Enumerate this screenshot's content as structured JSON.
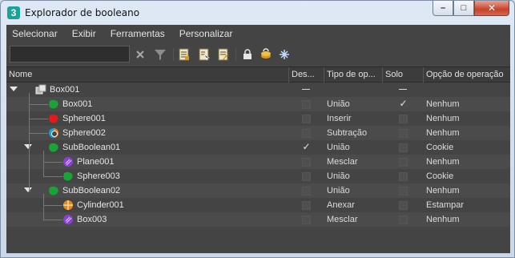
{
  "window": {
    "title": "Explorador de booleano",
    "app_icon_glyph": "3",
    "buttons": {
      "minimize": "–",
      "maximize": "□",
      "close": "✕"
    }
  },
  "menu": [
    "Selecionar",
    "Exibir",
    "Ferramentas",
    "Personalizar"
  ],
  "toolbar": {
    "search_value": "",
    "icons": [
      "clear-search-icon",
      "filter-icon",
      "document-list-icon",
      "document-select-icon",
      "document-edit-icon",
      "lock-icon",
      "layers-icon",
      "freeze-icon"
    ]
  },
  "columns": [
    "Nome",
    "Des...",
    "Tipo de op...",
    "Solo",
    "Opção de operação"
  ],
  "rows": [
    {
      "name": "Box001",
      "level": 0,
      "expandable": true,
      "icon": "boolean-object-icon",
      "icon_color": "#d8d8d8",
      "disable": "dash",
      "type": "",
      "solo": "dash",
      "op": ""
    },
    {
      "name": "Box001",
      "level": 1,
      "expandable": false,
      "icon": "green-operand-icon",
      "icon_color": "#19a535",
      "disable": "off",
      "type": "União",
      "solo": "on",
      "op": "Nenhum"
    },
    {
      "name": "Sphere001",
      "level": 1,
      "expandable": false,
      "icon": "red-operand-icon",
      "icon_color": "#e01b1b",
      "disable": "off",
      "type": "Inserir",
      "solo": "off",
      "op": "Nenhum"
    },
    {
      "name": "Sphere002",
      "level": 1,
      "expandable": false,
      "icon": "subtract-operand-icon",
      "icon_color": "#1ea0e0",
      "disable": "off",
      "type": "Subtração",
      "solo": "off",
      "op": "Nenhum"
    },
    {
      "name": "SubBoolean01",
      "level": 1,
      "expandable": true,
      "icon": "green-operand-icon",
      "icon_color": "#19a535",
      "disable": "on",
      "type": "União",
      "solo": "off",
      "op": "Cookie"
    },
    {
      "name": "Plane001",
      "level": 2,
      "expandable": false,
      "icon": "purple-operand-icon",
      "icon_color": "#8a3fd6",
      "disable": "off",
      "type": "Mesclar",
      "solo": "off",
      "op": "Nenhum"
    },
    {
      "name": "Sphere003",
      "level": 2,
      "expandable": false,
      "icon": "green-operand-icon",
      "icon_color": "#19a535",
      "disable": "off",
      "type": "União",
      "solo": "off",
      "op": "Cookie"
    },
    {
      "name": "SubBoolean02",
      "level": 1,
      "expandable": true,
      "icon": "green-operand-icon",
      "icon_color": "#19a535",
      "disable": "off",
      "type": "União",
      "solo": "off",
      "op": "Nenhum"
    },
    {
      "name": "Cylinder001",
      "level": 2,
      "expandable": false,
      "icon": "orange-attach-icon",
      "icon_color": "#e88a12",
      "disable": "off",
      "type": "Anexar",
      "solo": "off",
      "op": "Estampar"
    },
    {
      "name": "Box003",
      "level": 2,
      "expandable": false,
      "icon": "purple-operand-icon",
      "icon_color": "#8a3fd6",
      "disable": "off",
      "type": "Mesclar",
      "solo": "off",
      "op": "Nenhum"
    }
  ]
}
